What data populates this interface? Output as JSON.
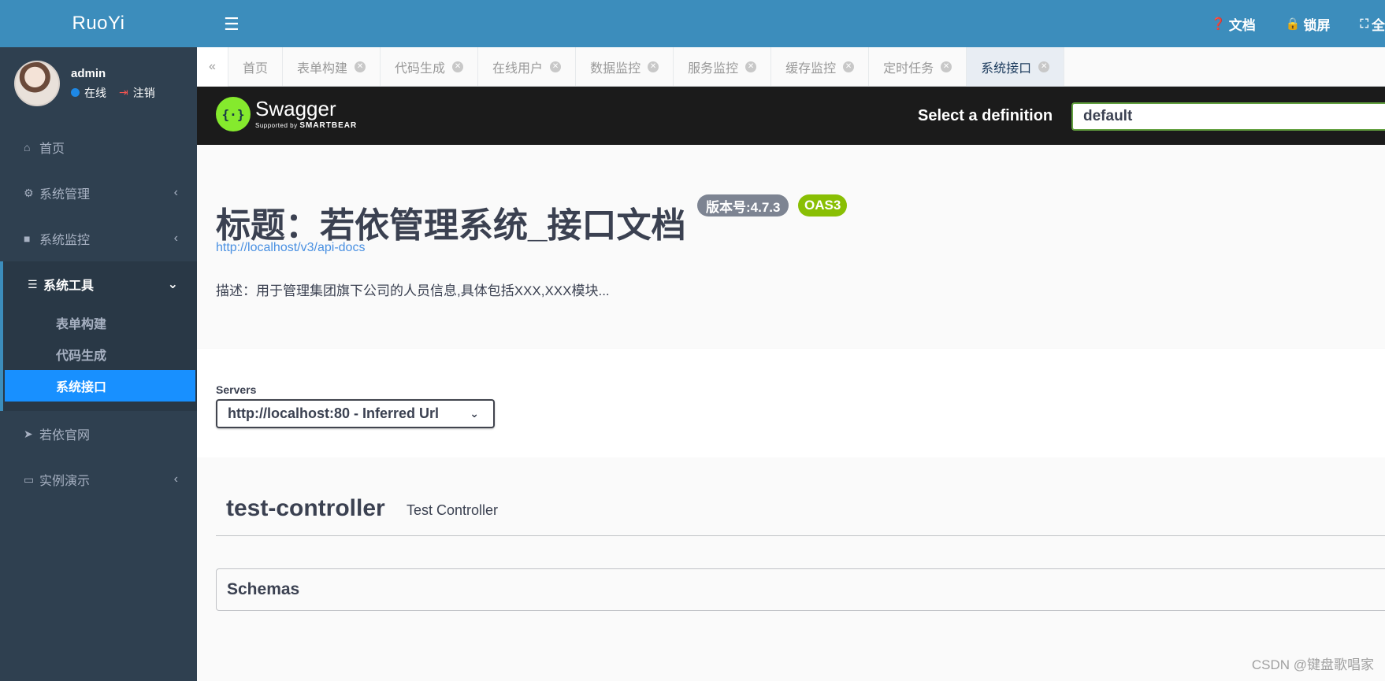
{
  "sidebar": {
    "logo": "RuoYi",
    "user": {
      "name": "admin",
      "status": "在线",
      "logout": "注销"
    },
    "menu": [
      {
        "label": "首页",
        "icon": "home-icon"
      },
      {
        "label": "系统管理",
        "icon": "gear-icon"
      },
      {
        "label": "系统监控",
        "icon": "video-icon"
      },
      {
        "label": "系统工具",
        "icon": "bars-icon"
      }
    ],
    "submenu": [
      "表单构建",
      "代码生成",
      "系统接口"
    ],
    "menu_after": [
      {
        "label": "若依官网",
        "icon": "send-icon"
      },
      {
        "label": "实例演示",
        "icon": "desktop-icon"
      }
    ]
  },
  "topbar": {
    "docs": "文档",
    "lock": "锁屏",
    "fullscreen": "全"
  },
  "tabs": [
    "首页",
    "表单构建",
    "代码生成",
    "在线用户",
    "数据监控",
    "服务监控",
    "缓存监控",
    "定时任务",
    "系统接口"
  ],
  "swagger": {
    "logo_text": "Swagger",
    "logo_sub": "Supported by",
    "logo_brand": "SMARTBEAR",
    "select_label": "Select a definition",
    "select_value": "default",
    "title": "标题：若依管理系统_接口文档",
    "version_badge": "版本号:4.7.3",
    "oas_badge": "OAS3",
    "url": "http://localhost/v3/api-docs",
    "description": "描述：用于管理集团旗下公司的人员信息,具体包括XXX,XXX模块...",
    "servers_label": "Servers",
    "servers_value": "http://localhost:80 - Inferred Url",
    "tag_name": "test-controller",
    "tag_desc": "Test Controller",
    "schemas": "Schemas"
  },
  "watermark": "CSDN @键盘歌唱家",
  "colors": {
    "topbar": "#3c8dbc",
    "sidebar": "#2f4050",
    "active_sub": "#1890ff",
    "swagger_green": "#85ea2d"
  }
}
